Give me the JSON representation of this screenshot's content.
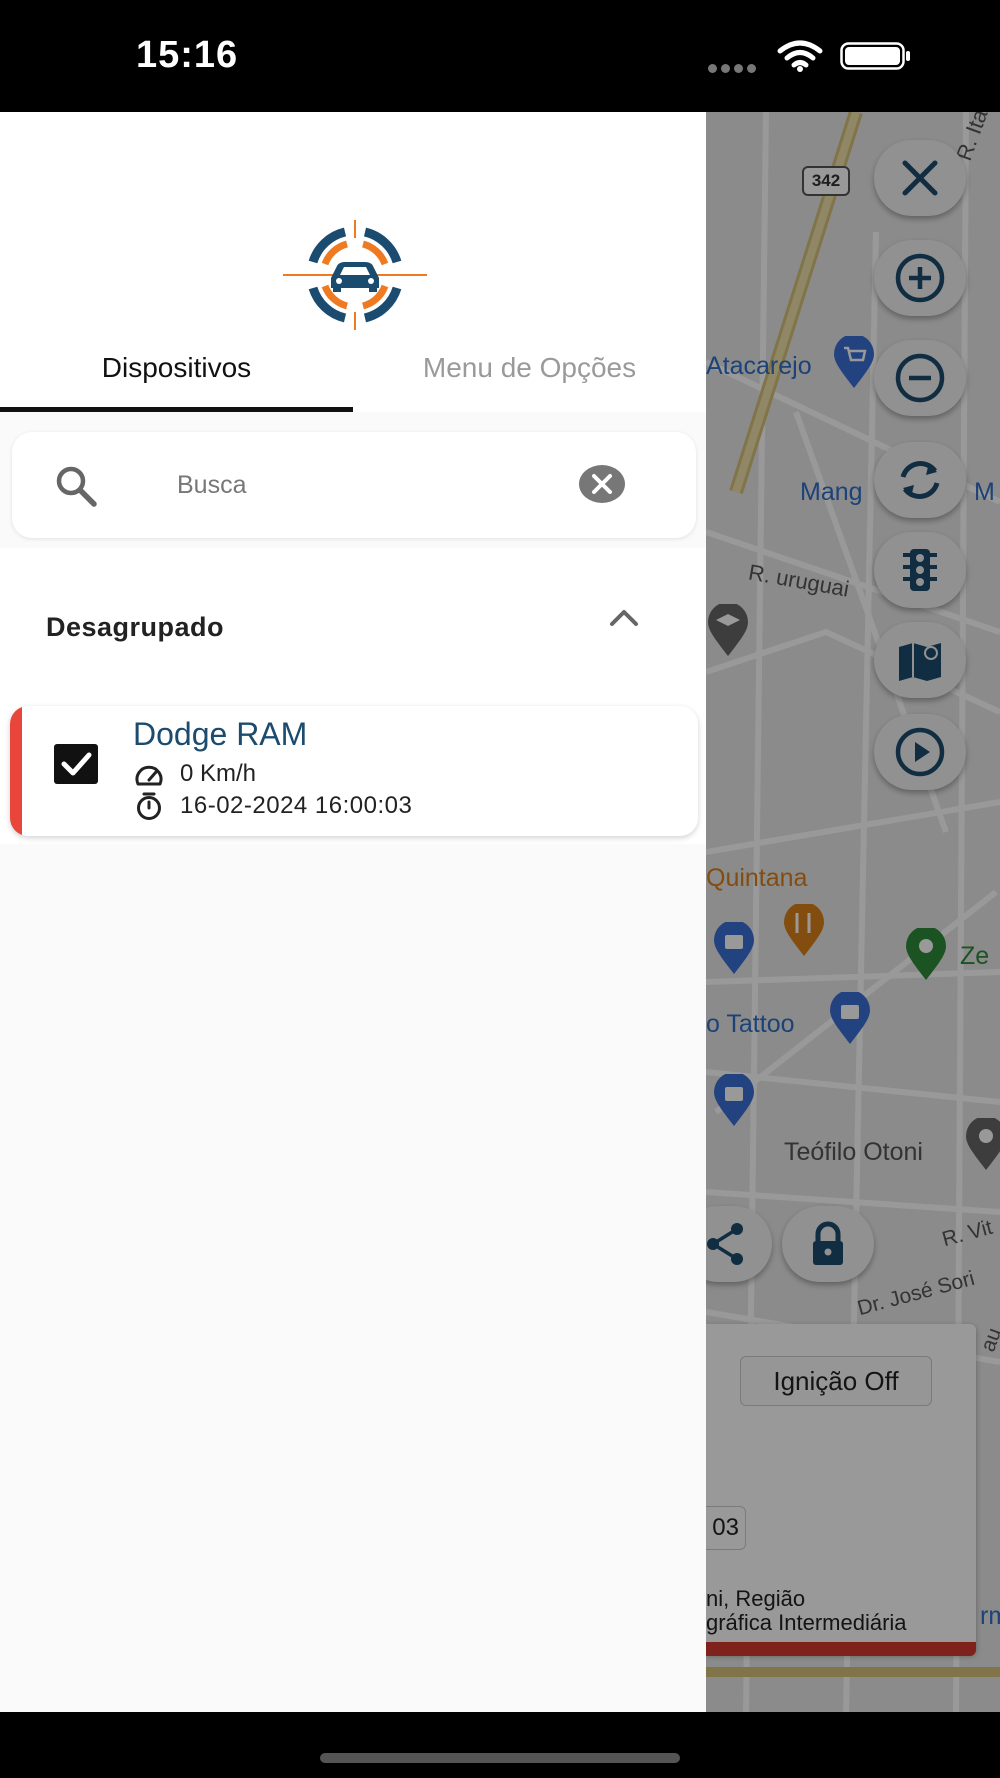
{
  "status_bar": {
    "time": "15:16"
  },
  "drawer": {
    "tabs": [
      {
        "label": "Dispositivos",
        "active": true
      },
      {
        "label": "Menu de Opções",
        "active": false
      }
    ],
    "search": {
      "placeholder": "Busca",
      "value": ""
    },
    "group": {
      "title": "Desagrupado",
      "devices": [
        {
          "name": "Dodge RAM",
          "speed": "0 Km/h",
          "timestamp": "16-02-2024 16:00:03",
          "checked": true,
          "status_color": "#e8463b"
        }
      ]
    }
  },
  "map": {
    "road_shield": "342",
    "labels": {
      "street_1": "R. Ita",
      "poi_1": "Atacarejo",
      "poi_2": "Mang",
      "poi_2b": "M",
      "street_2": "R. uruguai",
      "poi_3": "Quintana",
      "poi_4": "Ze",
      "poi_5": "o Tattoo",
      "area_1": "Teófilo Otoni",
      "street_3": "R. Vit",
      "street_4": "Dr. José Sori",
      "street_5": "au"
    },
    "controls": [
      "close-icon",
      "zoom-in-icon",
      "zoom-out-icon",
      "refresh-icon",
      "traffic-light-icon",
      "map-layers-icon",
      "play-icon",
      "share-icon",
      "lock-icon"
    ],
    "info_card": {
      "ignition": "Ignição Off",
      "partial_value": "03",
      "address_line_1": "ni, Região",
      "address_line_2": "gráfica Intermediária",
      "edge_text": "rm"
    }
  },
  "colors": {
    "accent_dark": "#1b4b6e",
    "accent_orange": "#ee7a22",
    "status_red": "#e8463b"
  }
}
